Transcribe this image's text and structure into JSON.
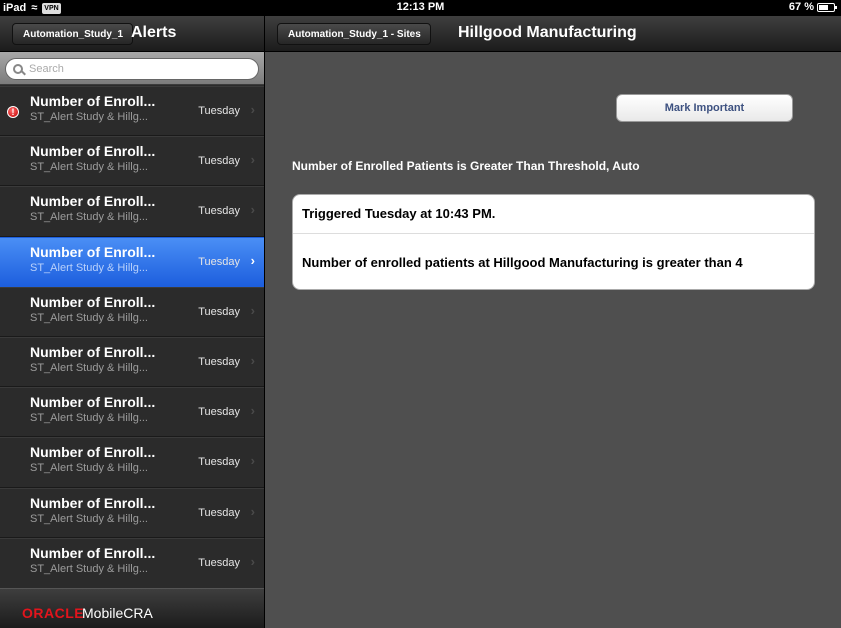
{
  "status_bar": {
    "device": "iPad",
    "vpn": "VPN",
    "time": "12:13 PM",
    "battery": "67 %",
    "battery_level": 0.67
  },
  "master": {
    "back_label": "Automation_Study_1",
    "title": "Alerts",
    "search_placeholder": "Search",
    "items": [
      {
        "title": "Number of Enroll...",
        "subtitle": "ST_Alert Study & Hillg...",
        "date": "Tuesday",
        "flagged": true,
        "selected": false
      },
      {
        "title": "Number of Enroll...",
        "subtitle": "ST_Alert Study & Hillg...",
        "date": "Tuesday",
        "flagged": false,
        "selected": false
      },
      {
        "title": "Number of Enroll...",
        "subtitle": "ST_Alert Study & Hillg...",
        "date": "Tuesday",
        "flagged": false,
        "selected": false
      },
      {
        "title": "Number of Enroll...",
        "subtitle": "ST_Alert Study & Hillg...",
        "date": "Tuesday",
        "flagged": false,
        "selected": true
      },
      {
        "title": "Number of Enroll...",
        "subtitle": "ST_Alert Study & Hillg...",
        "date": "Tuesday",
        "flagged": false,
        "selected": false
      },
      {
        "title": "Number of Enroll...",
        "subtitle": "ST_Alert Study & Hillg...",
        "date": "Tuesday",
        "flagged": false,
        "selected": false
      },
      {
        "title": "Number of Enroll...",
        "subtitle": "ST_Alert Study & Hillg...",
        "date": "Tuesday",
        "flagged": false,
        "selected": false
      },
      {
        "title": "Number of Enroll...",
        "subtitle": "ST_Alert Study & Hillg...",
        "date": "Tuesday",
        "flagged": false,
        "selected": false
      },
      {
        "title": "Number of Enroll...",
        "subtitle": "ST_Alert Study & Hillg...",
        "date": "Tuesday",
        "flagged": false,
        "selected": false
      },
      {
        "title": "Number of Enroll...",
        "subtitle": "ST_Alert Study & Hillg...",
        "date": "Tuesday",
        "flagged": false,
        "selected": false
      }
    ],
    "footer": {
      "brand": "ORACLE",
      "app_name": "MobileCRA"
    }
  },
  "detail": {
    "back_label": "Automation_Study_1 - Sites",
    "title": "Hillgood Manufacturing",
    "mark_important_label": "Mark Important",
    "alert_heading": "Number of Enrolled Patients is Greater Than Threshold, Auto",
    "triggered": "Triggered Tuesday at 10:43 PM.",
    "message": "Number of enrolled patients at Hillgood Manufacturing is greater than 4"
  },
  "colors": {
    "selection": "#1d5fde",
    "brand_red": "#e3141c",
    "detail_bg": "#4f4f4f",
    "master_bg": "#2b2b2b"
  }
}
